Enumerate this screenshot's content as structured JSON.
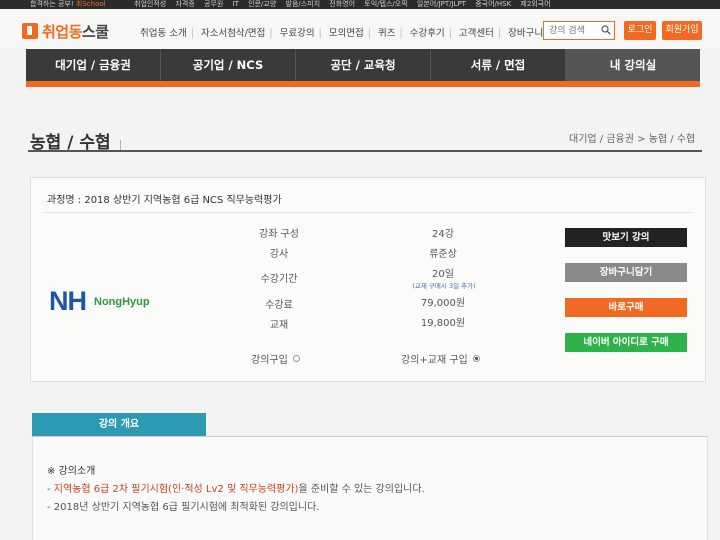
{
  "topbar": {
    "promo_prefix": "합격하는 공부!",
    "promo_brand": "취School",
    "links": [
      "취업인적성",
      "자격증",
      "공무원",
      "IT",
      "인문/교양",
      "발음/스피치",
      "전화영어",
      "토익/텝스/오픽",
      "일본어/JPT/JLPT",
      "중국어/HSK",
      "제2외국어"
    ]
  },
  "header": {
    "logo_orange": "취업동",
    "logo_dark": "스쿨",
    "nav": [
      "취업동 소개",
      "자소서첨삭/면접",
      "무료강의",
      "모의면접",
      "퀴즈",
      "수강후기",
      "고객센터",
      "장바구니"
    ],
    "search_placeholder": "강의 검색",
    "login_label": "로그인",
    "join_label": "회원가입"
  },
  "mainnav": {
    "tabs": [
      "대기업 / 금융권",
      "공기업 / NCS",
      "공단 / 교육청",
      "서류 / 면접",
      "내 강의실"
    ]
  },
  "page": {
    "title": "농협 / 수협",
    "title_bar": "|",
    "breadcrumb": "대기업 / 금융권 > 농협 / 수협"
  },
  "course": {
    "name": "과정명 : 2018 상반기 지역농협 6급 NCS 직무능력평가",
    "logo_nh": "NH",
    "logo_nonghyup": "NongHyup",
    "rows": [
      {
        "label": "강좌 구성",
        "value": "24강"
      },
      {
        "label": "강사",
        "value": "류준상"
      },
      {
        "label": "수강기간",
        "value": "20일"
      },
      {
        "label": "수강료",
        "value": "79,000원"
      },
      {
        "label": "교재",
        "value": "19,800원"
      }
    ],
    "period_note": "(교재 구매시 3일 추가)",
    "option_lecture": "강의구입",
    "option_bundle": "강의+교재 구입",
    "selected_option": "강의+교재 구입",
    "buttons": {
      "preview": "맛보기 강의",
      "cart": "장바구니담기",
      "buy": "바로구매",
      "naver": "네이버 아이디로 구매"
    }
  },
  "overview": {
    "tab_label": "강의 개요",
    "title": "※ 강의소개",
    "line1_prefix": "- ",
    "line1_highlight": "지역농협 6급 2차 필기시험(인·적성 Lv2 및 직무능력평가)",
    "line1_suffix": "을 준비할 수 있는 강의입니다.",
    "line2": "- 2018년 상반기 지역농협 6급 필기시험에 최적화된 강의입니다."
  }
}
